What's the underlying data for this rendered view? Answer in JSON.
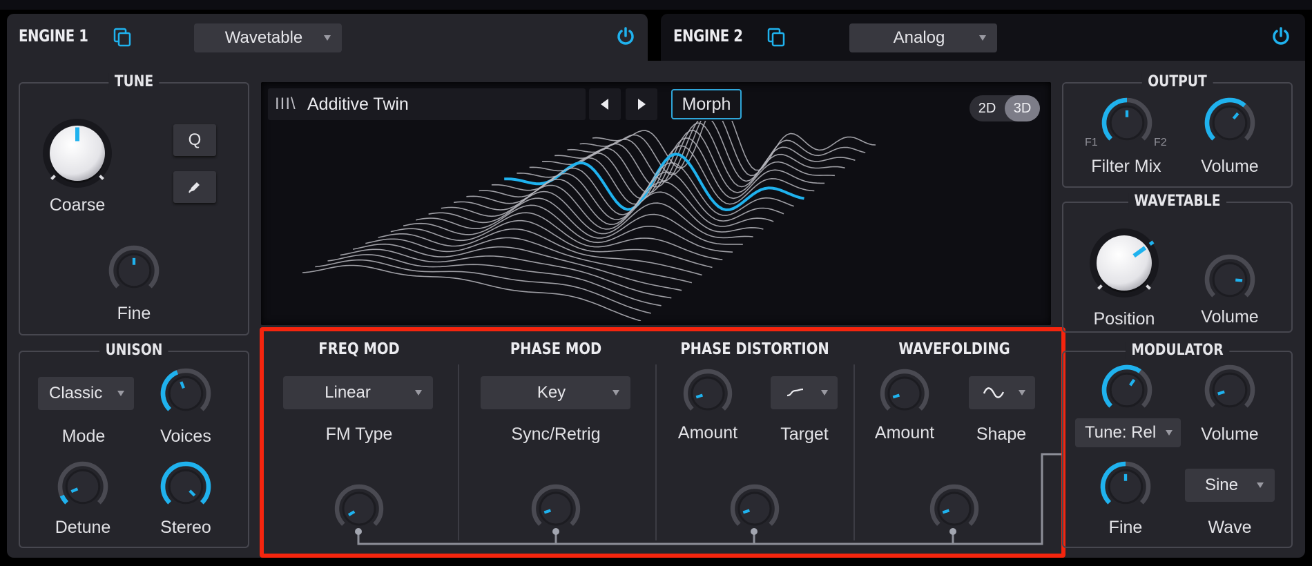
{
  "engine1": {
    "title": "ENGINE 1",
    "type_selected": "Wavetable",
    "power_on": true,
    "tune": {
      "title": "TUNE",
      "coarse_label": "Coarse",
      "coarse_value": 0.5,
      "fine_label": "Fine",
      "fine_value": 0.5,
      "quantize_button": "Q",
      "edit_button_icon": "pencil-icon"
    },
    "unison": {
      "title": "UNISON",
      "mode_selected": "Classic",
      "mode_label": "Mode",
      "voices_label": "Voices",
      "voices_value": 0.42,
      "detune_label": "Detune",
      "detune_value": 0.08,
      "stereo_label": "Stereo",
      "stereo_value": 1.0
    },
    "display": {
      "preset_icon": "library-icon",
      "preset_icon_text": "III\\",
      "preset_name": "Additive Twin",
      "morph_label": "Morph",
      "view_2d": "2D",
      "view_3d": "3D",
      "view_selected": "3D"
    },
    "modulation": {
      "freq_mod": {
        "title": "FREQ MOD",
        "type_selected": "Linear",
        "type_label": "FM Type",
        "amount_value": 0.05
      },
      "phase_mod": {
        "title": "PHASE MOD",
        "sync_selected": "Key",
        "sync_label": "Sync/Retrig",
        "amount_value": 0.1
      },
      "phase_distortion": {
        "title": "PHASE DISTORTION",
        "amount_label": "Amount",
        "amount_value": 0.1,
        "target_label": "Target",
        "target_icon": "curve-icon",
        "mod_value": 0.1
      },
      "wavefolding": {
        "title": "WAVEFOLDING",
        "amount_label": "Amount",
        "amount_value": 0.1,
        "shape_label": "Shape",
        "shape_icon": "sine-icon",
        "mod_value": 0.1
      }
    },
    "output": {
      "title": "OUTPUT",
      "filter_mix_label": "Filter Mix",
      "filter_mix_left": "F1",
      "filter_mix_right": "F2",
      "filter_mix_value": 0.5,
      "volume_label": "Volume",
      "volume_value": 0.65
    },
    "wavetable": {
      "title": "WAVETABLE",
      "position_label": "Position",
      "position_value": 0.7,
      "volume_label": "Volume",
      "volume_value": 0.85
    },
    "modulator": {
      "title": "MODULATOR",
      "tune_value": 0.63,
      "tune_mode_selected": "Tune: Rel",
      "volume_label": "Volume",
      "volume_value": 0.1,
      "fine_label": "Fine",
      "fine_value": 0.5,
      "wave_selected": "Sine",
      "wave_label": "Wave"
    }
  },
  "engine2": {
    "title": "ENGINE 2",
    "type_selected": "Analog",
    "power_on": true
  },
  "colors": {
    "accent": "#1fb2ee",
    "highlight_box": "#f5250e",
    "panel": "#25252b"
  }
}
